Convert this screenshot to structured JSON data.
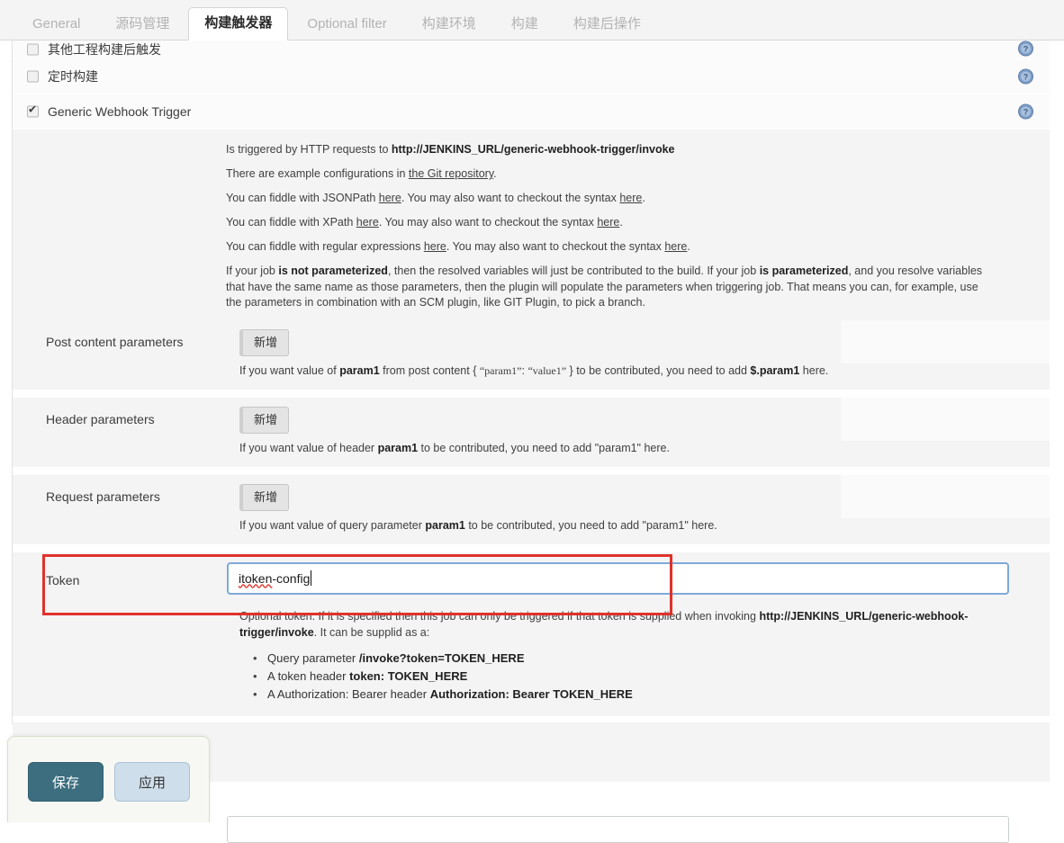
{
  "tabs": [
    {
      "label": "General",
      "active": false
    },
    {
      "label": "源码管理",
      "active": false
    },
    {
      "label": "构建触发器",
      "active": true
    },
    {
      "label": "Optional filter",
      "active": false
    },
    {
      "label": "构建环境",
      "active": false
    },
    {
      "label": "构建",
      "active": false
    },
    {
      "label": "构建后操作",
      "active": false
    }
  ],
  "triggers": [
    {
      "label": "其他工程构建后触发",
      "checked": false
    },
    {
      "label": "定时构建",
      "checked": false
    },
    {
      "label": "Generic Webhook Trigger",
      "checked": true
    }
  ],
  "description": {
    "line1_prefix": "Is triggered by HTTP requests to ",
    "line1_url": "http://JENKINS_URL/generic-webhook-trigger/invoke",
    "line2_prefix": "There are example configurations in ",
    "line2_link": "the Git repository",
    "line2_suffix": ".",
    "line3_prefix": "You can fiddle with JSONPath ",
    "line3_link1": "here",
    "line3_middle": ". You may also want to checkout the syntax ",
    "line3_link2": "here",
    "line3_suffix": ".",
    "line4_prefix": "You can fiddle with XPath ",
    "line4_link1": "here",
    "line4_middle": ". You may also want to checkout the syntax ",
    "line4_link2": "here",
    "line4_suffix": ".",
    "line5_prefix": "You can fiddle with regular expressions ",
    "line5_link1": "here",
    "line5_middle": ". You may also want to checkout the syntax ",
    "line5_link2": "here",
    "line5_suffix": ".",
    "para_seg1": "If your job ",
    "para_bold1": "is not parameterized",
    "para_seg2": ", then the resolved variables will just be contributed to the build. If your job ",
    "para_bold2": "is parameterized",
    "para_seg3": ", and you resolve variables that have the same name as those parameters, then the plugin will populate the parameters when triggering job. That means you can, for example, use the parameters in combination with an SCM plugin, like GIT Plugin, to pick a branch."
  },
  "params": {
    "post_content": {
      "label": "Post content parameters",
      "add_label": "新增",
      "hint_seg1": "If you want value of ",
      "hint_bold1": "param1",
      "hint_seg2": " from post content { ",
      "hint_sample1": "“param1”",
      "hint_seg3": ": ",
      "hint_sample2": "“value1”",
      "hint_seg4": " } to be contributed, you need to add ",
      "hint_bold2": "$.param1",
      "hint_seg5": " here."
    },
    "header": {
      "label": "Header parameters",
      "add_label": "新增",
      "hint_seg1": "If you want value of header ",
      "hint_bold1": "param1",
      "hint_seg2": " to be contributed, you need to add \"param1\" here."
    },
    "request": {
      "label": "Request parameters",
      "add_label": "新增",
      "hint_seg1": "If you want value of query parameter ",
      "hint_bold1": "param1",
      "hint_seg2": " to be contributed, you need to add \"param1\" here."
    }
  },
  "token": {
    "label": "Token",
    "value": "itoken-config",
    "value_misspelled_part": "itoken",
    "value_rest": "-config",
    "desc_seg1": "Optional token. If it is specified then this job can only be triggered if that token is supplied when invoking ",
    "desc_bold": "http://JENKINS_URL/generic-webhook-trigger/invoke",
    "desc_seg2": ". It can be supplid as a:",
    "bullets": [
      {
        "plain": "Query parameter ",
        "bold": "/invoke?token=TOKEN_HERE",
        "tail": ""
      },
      {
        "plain": "A token header ",
        "bold": "token: TOKEN_HERE",
        "tail": ""
      },
      {
        "plain": "A Authorization: Bearer header ",
        "bold": "Authorization: Bearer TOKEN_HERE",
        "tail": ""
      }
    ]
  },
  "footer": {
    "save_label": "保存",
    "apply_label": "应用"
  },
  "colors": {
    "accent_save": "#3c6e7f",
    "accent_apply": "#cfdeeb",
    "highlight_box": "#e0322b",
    "input_focus_border": "#7da9d9",
    "spellcheck_underline": "#e03a2f",
    "help_icon": "#6b8fc0"
  }
}
